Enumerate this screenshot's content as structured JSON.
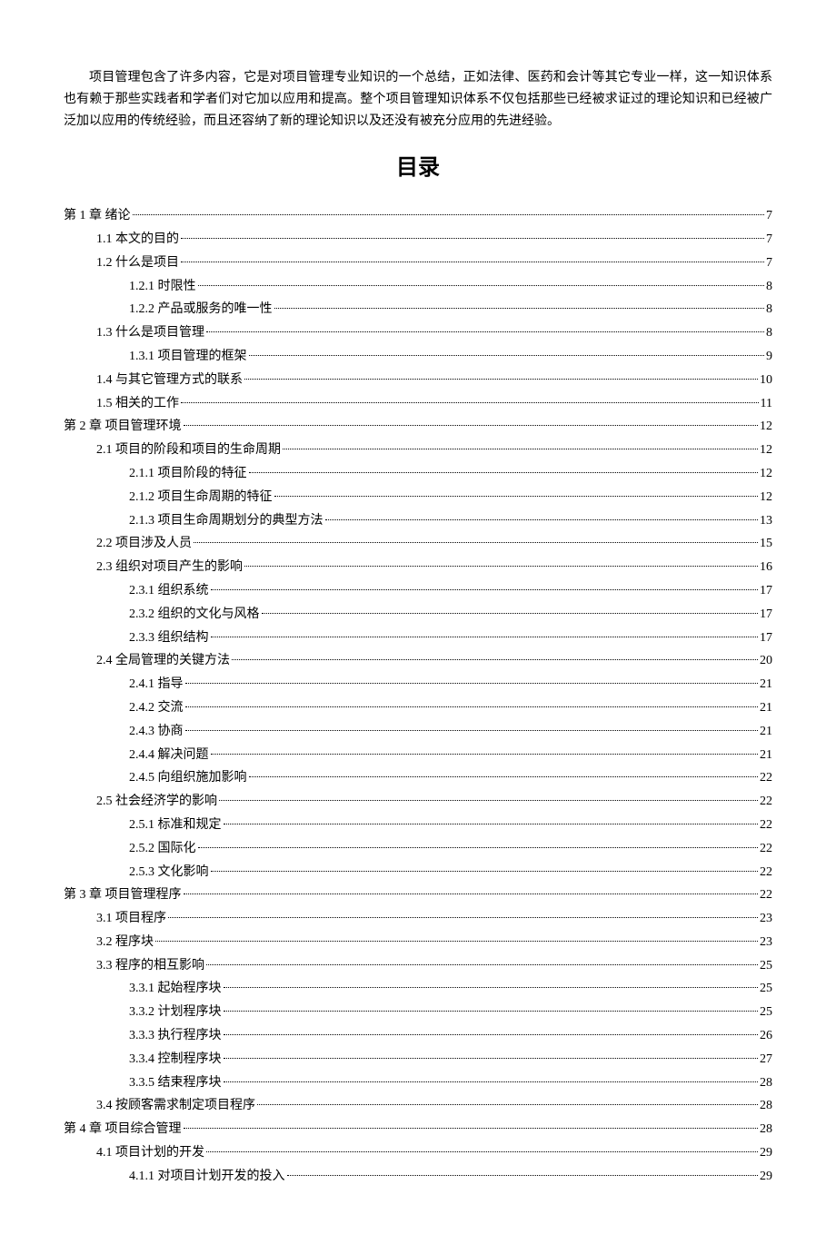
{
  "intro": "项目管理包含了许多内容，它是对项目管理专业知识的一个总结，正如法律、医药和会计等其它专业一样，这一知识体系也有赖于那些实践者和学者们对它加以应用和提高。整个项目管理知识体系不仅包括那些已经被求证过的理论知识和已经被广 泛加以应用的传统经验，而且还容纳了新的理论知识以及还没有被充分应用的先进经验。",
  "toc_title": "目录",
  "toc": [
    {
      "level": 0,
      "label": "第 1 章 绪论",
      "page": "7"
    },
    {
      "level": 1,
      "label": "1.1 本文的目的",
      "page": "7"
    },
    {
      "level": 1,
      "label": "1.2 什么是项目",
      "page": "7"
    },
    {
      "level": 2,
      "label": "1.2.1 时限性",
      "page": "8"
    },
    {
      "level": 2,
      "label": "1.2.2 产品或服务的唯一性",
      "page": "8"
    },
    {
      "level": 1,
      "label": "1.3 什么是项目管理",
      "page": "8"
    },
    {
      "level": 2,
      "label": "1.3.1 项目管理的框架",
      "page": "9"
    },
    {
      "level": 1,
      "label": "1.4 与其它管理方式的联系",
      "page": "10"
    },
    {
      "level": 1,
      "label": "1.5 相关的工作",
      "page": "11"
    },
    {
      "level": 0,
      "label": "第 2 章 项目管理环境",
      "page": "12"
    },
    {
      "level": 1,
      "label": "2.1 项目的阶段和项目的生命周期",
      "page": "12"
    },
    {
      "level": 2,
      "label": "2.1.1 项目阶段的特征",
      "page": "12"
    },
    {
      "level": 2,
      "label": "2.1.2 项目生命周期的特征",
      "page": "12"
    },
    {
      "level": 2,
      "label": "2.1.3 项目生命周期划分的典型方法",
      "page": "13"
    },
    {
      "level": 1,
      "label": "2.2 项目涉及人员",
      "page": "15"
    },
    {
      "level": 1,
      "label": "2.3 组织对项目产生的影响",
      "page": "16"
    },
    {
      "level": 2,
      "label": "2.3.1 组织系统",
      "page": "17"
    },
    {
      "level": 2,
      "label": "2.3.2 组织的文化与风格",
      "page": "17"
    },
    {
      "level": 2,
      "label": "2.3.3 组织结构",
      "page": "17"
    },
    {
      "level": 1,
      "label": "2.4 全局管理的关键方法",
      "page": "20"
    },
    {
      "level": 2,
      "label": "2.4.1 指导",
      "page": "21"
    },
    {
      "level": 2,
      "label": "2.4.2 交流",
      "page": "21"
    },
    {
      "level": 2,
      "label": "2.4.3 协商",
      "page": "21"
    },
    {
      "level": 2,
      "label": "2.4.4 解决问题",
      "page": "21"
    },
    {
      "level": 2,
      "label": "2.4.5 向组织施加影响",
      "page": "22"
    },
    {
      "level": 1,
      "label": "2.5 社会经济学的影响",
      "page": "22"
    },
    {
      "level": 2,
      "label": "2.5.1 标准和规定",
      "page": "22"
    },
    {
      "level": 2,
      "label": "2.5.2 国际化",
      "page": "22"
    },
    {
      "level": 2,
      "label": "2.5.3 文化影响",
      "page": "22"
    },
    {
      "level": 0,
      "label": "第 3 章 项目管理程序",
      "page": "22"
    },
    {
      "level": 1,
      "label": "3.1 项目程序",
      "page": "23"
    },
    {
      "level": 1,
      "label": "3.2 程序块",
      "page": "23"
    },
    {
      "level": 1,
      "label": "3.3 程序的相互影响",
      "page": "25"
    },
    {
      "level": 2,
      "label": "3.3.1 起始程序块",
      "page": "25"
    },
    {
      "level": 2,
      "label": "3.3.2 计划程序块",
      "page": "25"
    },
    {
      "level": 2,
      "label": "3.3.3 执行程序块",
      "page": "26"
    },
    {
      "level": 2,
      "label": "3.3.4 控制程序块",
      "page": "27"
    },
    {
      "level": 2,
      "label": "3.3.5 结束程序块",
      "page": "28"
    },
    {
      "level": 1,
      "label": "3.4 按顾客需求制定项目程序",
      "page": "28"
    },
    {
      "level": 0,
      "label": "第 4 章 项目综合管理",
      "page": "28"
    },
    {
      "level": 1,
      "label": "4.1 项目计划的开发",
      "page": "29"
    },
    {
      "level": 2,
      "label": "4.1.1 对项目计划开发的投入",
      "page": "29"
    }
  ]
}
